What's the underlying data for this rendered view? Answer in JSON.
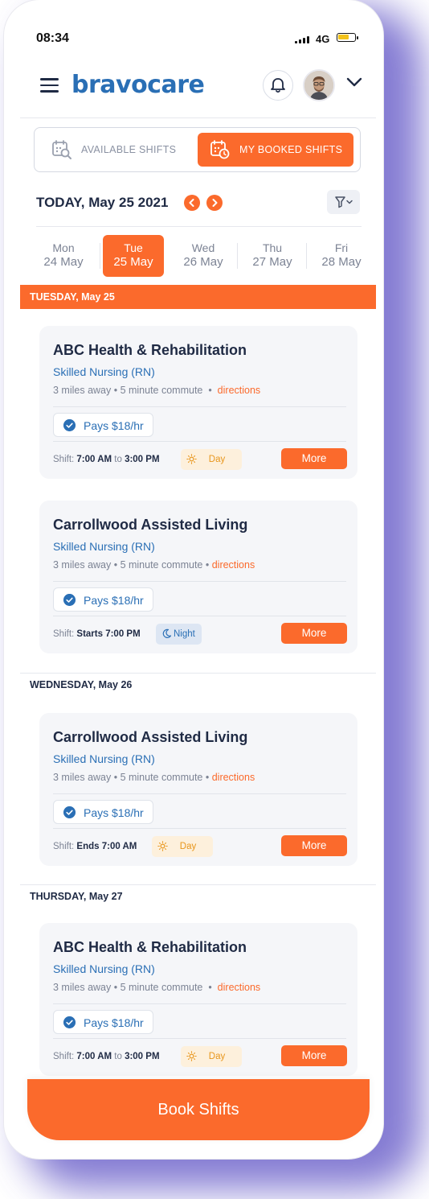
{
  "status_bar": {
    "time": "08:34",
    "network": "4G"
  },
  "header": {
    "logo": "bravocare"
  },
  "tabs": {
    "available": "AVAILABLE SHIFTS",
    "booked": "MY BOOKED SHIFTS",
    "selected": "booked"
  },
  "date_nav": {
    "today_label": "TODAY, May 25 2021"
  },
  "days": [
    {
      "dow": "Mon",
      "date": "24 May",
      "selected": false
    },
    {
      "dow": "Tue",
      "date": "25 May",
      "selected": true
    },
    {
      "dow": "Wed",
      "date": "26 May",
      "selected": false
    },
    {
      "dow": "Thu",
      "date": "27 May",
      "selected": false
    },
    {
      "dow": "Fri",
      "date": "28 May",
      "selected": false
    }
  ],
  "sections": [
    {
      "heading": "TUESDAY, May 25",
      "cards": [
        {
          "facility": "ABC Health & Rehabilitation",
          "role": "Skilled Nursing (RN)",
          "distance": "3 miles away • 5 minute commute",
          "directions": "directions",
          "pays": "Pays $18/hr",
          "shift_prefix": "Shift: ",
          "shift_bold": "7:00 AM",
          "shift_mid": " to ",
          "shift_bold2": "3:00 PM",
          "tag": "Day",
          "tag_type": "day",
          "more": "More"
        },
        {
          "facility": "Carrollwood Assisted Living",
          "role": "Skilled Nursing (RN)",
          "distance": "3 miles away • 5 minute commute",
          "directions": "directions",
          "pays": "Pays $18/hr",
          "shift_prefix": "Shift: ",
          "shift_bold": "Starts 7:00 PM",
          "shift_mid": "",
          "shift_bold2": "",
          "tag": "Night",
          "tag_type": "night",
          "more": "More"
        }
      ]
    },
    {
      "heading": "WEDNESDAY, May 26",
      "cards": [
        {
          "facility": "Carrollwood Assisted Living",
          "role": "Skilled Nursing (RN)",
          "distance": "3 miles away • 5 minute commute",
          "directions": "directions",
          "pays": "Pays $18/hr",
          "shift_prefix": "Shift: ",
          "shift_bold": "Ends 7:00 AM",
          "shift_mid": "",
          "shift_bold2": "",
          "tag": "Day",
          "tag_type": "day",
          "more": "More"
        }
      ]
    },
    {
      "heading": "THURSDAY, May 27",
      "cards": [
        {
          "facility": "ABC Health & Rehabilitation",
          "role": "Skilled Nursing (RN)",
          "distance": "3 miles away • 5 minute commute",
          "directions": "directions",
          "pays": "Pays $18/hr",
          "shift_prefix": "Shift: ",
          "shift_bold": "7:00 AM",
          "shift_mid": " to ",
          "shift_bold2": "3:00 PM",
          "tag": "Day",
          "tag_type": "day",
          "more": "More"
        }
      ]
    }
  ],
  "footer": {
    "book_label": "Book Shifts"
  },
  "icons": {
    "menu": "hamburger-menu-icon",
    "notifications": "bell-icon",
    "account": "chevron-down-icon",
    "available": "calendar-search-icon",
    "booked": "calendar-clock-icon",
    "prev": "chevron-left-icon",
    "next": "chevron-right-icon",
    "filter": "filter-icon",
    "pays": "check-circle-icon",
    "day": "sun-icon",
    "night": "moon-icon"
  },
  "colors": {
    "accent": "#fb6a2c",
    "brand": "#2a6fb5",
    "text": "#1f2a44",
    "muted": "#7c8394"
  }
}
